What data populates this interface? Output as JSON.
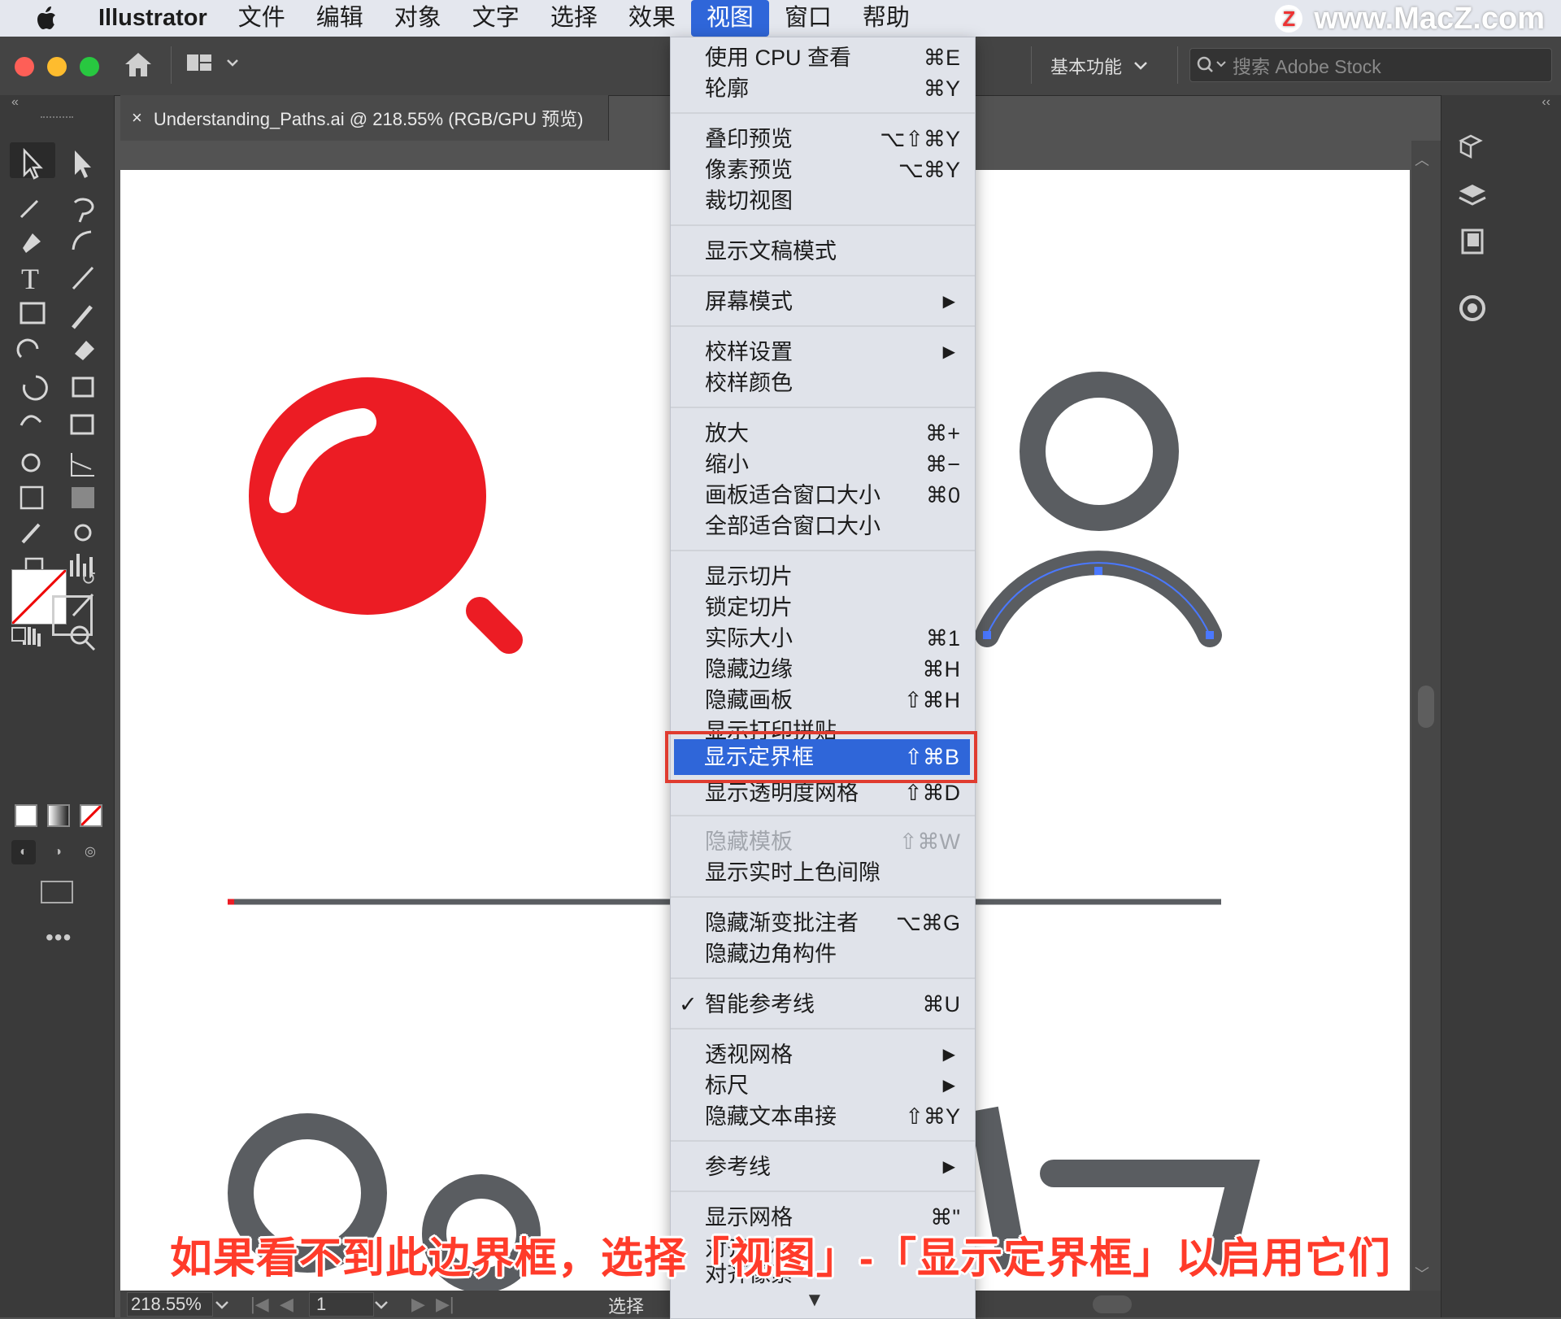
{
  "menubar": {
    "app_name": "Illustrator",
    "items": [
      "文件",
      "编辑",
      "对象",
      "文字",
      "选择",
      "效果",
      "视图",
      "窗口",
      "帮助"
    ],
    "active_item": "视图"
  },
  "watermark": {
    "logo_letter": "Z",
    "text": "www.MacZ.com"
  },
  "controlbar": {
    "workspace_label": "基本功能",
    "search_placeholder": "搜索 Adobe Stock"
  },
  "document_tab": {
    "close_glyph": "×",
    "title": "Understanding_Paths.ai @ 218.55% (RGB/GPU 预览)"
  },
  "view_menu": {
    "items": [
      {
        "label": "使用 CPU 查看",
        "shortcut": "⌘E"
      },
      {
        "label": "轮廓",
        "shortcut": "⌘Y"
      },
      {
        "label": "叠印预览",
        "shortcut": "⌥⇧⌘Y"
      },
      {
        "label": "像素预览",
        "shortcut": "⌥⌘Y"
      },
      {
        "label": "裁切视图",
        "shortcut": ""
      },
      {
        "label": "显示文稿模式",
        "shortcut": ""
      },
      {
        "label": "屏幕模式",
        "shortcut": "",
        "submenu": true
      },
      {
        "label": "校样设置",
        "shortcut": "",
        "submenu": true
      },
      {
        "label": "校样颜色",
        "shortcut": ""
      },
      {
        "label": "放大",
        "shortcut": "⌘+"
      },
      {
        "label": "缩小",
        "shortcut": "⌘−"
      },
      {
        "label": "画板适合窗口大小",
        "shortcut": "⌘0"
      },
      {
        "label": "全部适合窗口大小",
        "shortcut": ""
      },
      {
        "label": "显示切片",
        "shortcut": ""
      },
      {
        "label": "锁定切片",
        "shortcut": ""
      },
      {
        "label": "实际大小",
        "shortcut": "⌘1"
      },
      {
        "label": "隐藏边缘",
        "shortcut": "⌘H"
      },
      {
        "label": "隐藏画板",
        "shortcut": "⇧⌘H"
      },
      {
        "label": "显示打印拼贴",
        "shortcut": ""
      },
      {
        "label": "显示定界框",
        "shortcut": "⇧⌘B",
        "highlighted": true
      },
      {
        "label": "显示透明度网格",
        "shortcut": "⇧⌘D"
      },
      {
        "label": "隐藏模板",
        "shortcut": "⇧⌘W",
        "disabled": true
      },
      {
        "label": "显示实时上色间隙",
        "shortcut": ""
      },
      {
        "label": "隐藏渐变批注者",
        "shortcut": "⌥⌘G"
      },
      {
        "label": "隐藏边角构件",
        "shortcut": ""
      },
      {
        "label": "智能参考线",
        "shortcut": "⌘U",
        "checked": true
      },
      {
        "label": "透视网格",
        "shortcut": "",
        "submenu": true
      },
      {
        "label": "标尺",
        "shortcut": "",
        "submenu": true
      },
      {
        "label": "隐藏文本串接",
        "shortcut": "⇧⌘Y"
      },
      {
        "label": "参考线",
        "shortcut": "",
        "submenu": true
      },
      {
        "label": "显示网格",
        "shortcut": "⌘\""
      },
      {
        "label": "对齐网格",
        "shortcut": ""
      },
      {
        "label": "对齐像素",
        "shortcut": ""
      }
    ],
    "check_glyph": "✓",
    "submenu_glyph": "▶",
    "more_glyph": "▼"
  },
  "statusbar": {
    "zoom": "218.55%",
    "page": "1",
    "current_tool": "选择"
  },
  "subtitle": "如果看不到此边界框，选择「视图」-「显示定界框」以启用它们",
  "colors": {
    "accent_red": "#ec1c24",
    "shape_gray": "#5a5d61",
    "selection_blue": "#2f66d9",
    "highlight_outline": "#e03c30"
  }
}
